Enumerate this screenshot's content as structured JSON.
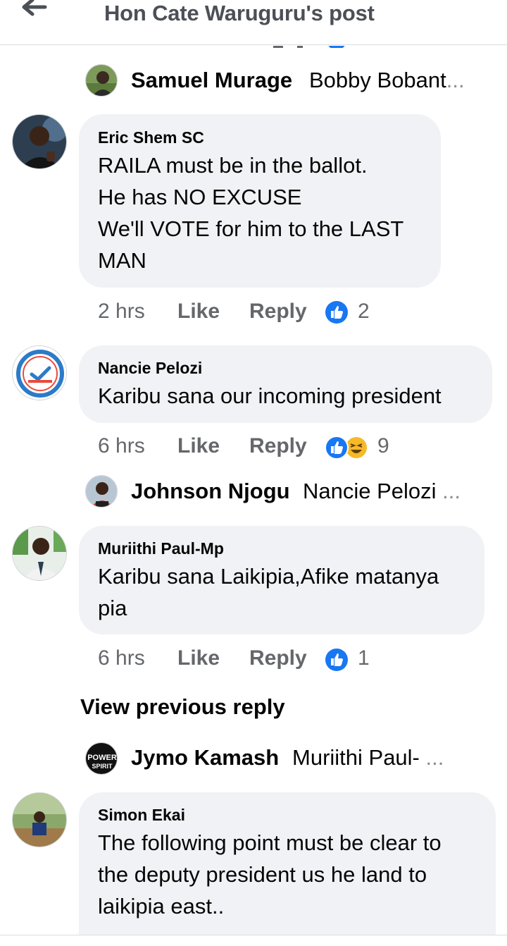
{
  "header": {
    "title": "Hon Cate Waruguru's post"
  },
  "replies_preview": [
    {
      "name": "Samuel Murage",
      "snippet": "Bobby Bobant",
      "ellipsis": "..."
    },
    {
      "name": "Johnson Njogu",
      "snippet": "Nancie Pelozi",
      "ellipsis": "..."
    },
    {
      "name": "Jymo Kamash",
      "snippet": "Muriithi Paul-",
      "ellipsis": "..."
    }
  ],
  "comments": [
    {
      "author": "Eric Shem SC",
      "lines": [
        "RAILA must be in the ballot.",
        "He has NO EXCUSE",
        "We'll VOTE for him to the LAST",
        "MAN"
      ],
      "time": "2 hrs",
      "like": "Like",
      "reply": "Reply",
      "reaction_count": "2"
    },
    {
      "author": "Nancie Pelozi",
      "lines": [
        "Karibu sana our incoming president"
      ],
      "time": "6 hrs",
      "like": "Like",
      "reply": "Reply",
      "reaction_count": "9"
    },
    {
      "author": "Muriithi Paul-Mp",
      "lines": [
        "Karibu sana Laikipia,Afike matanya",
        "pia"
      ],
      "time": "6 hrs",
      "like": "Like",
      "reply": "Reply",
      "reaction_count": "1"
    },
    {
      "author": "Simon Ekai",
      "lines": [
        "The following point must be clear to",
        "the deputy president us he land to",
        "laikipia east.."
      ]
    }
  ],
  "view_previous_reply": "View previous reply",
  "avatar_texts": {
    "power_spirit_top": "POWER",
    "power_spirit_bottom": "SPIRIT"
  },
  "colors": {
    "like_blue": "#1877f2",
    "bubble_gray": "#f0f2f5",
    "meta_gray": "#65676b",
    "haha_yellow": "#f7b928"
  }
}
